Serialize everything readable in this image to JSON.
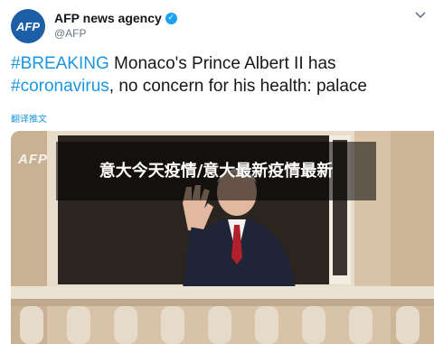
{
  "account": {
    "avatar_text": "AFP",
    "name": "AFP news agency",
    "handle": "@AFP",
    "verified_icon": "verified-check-icon"
  },
  "tweet": {
    "hashtag1": "#BREAKING",
    "text1": " Monaco's Prince Albert II has ",
    "hashtag2": "#coronavirus",
    "text2": ", no concern for his health: palace",
    "translate_label": "翻译推文"
  },
  "media": {
    "overlay_title": "意大今天疫情/意大最新疫情最新",
    "watermark": "AFP"
  },
  "colors": {
    "link": "#1b95e0",
    "brand": "#1d5fa6"
  }
}
